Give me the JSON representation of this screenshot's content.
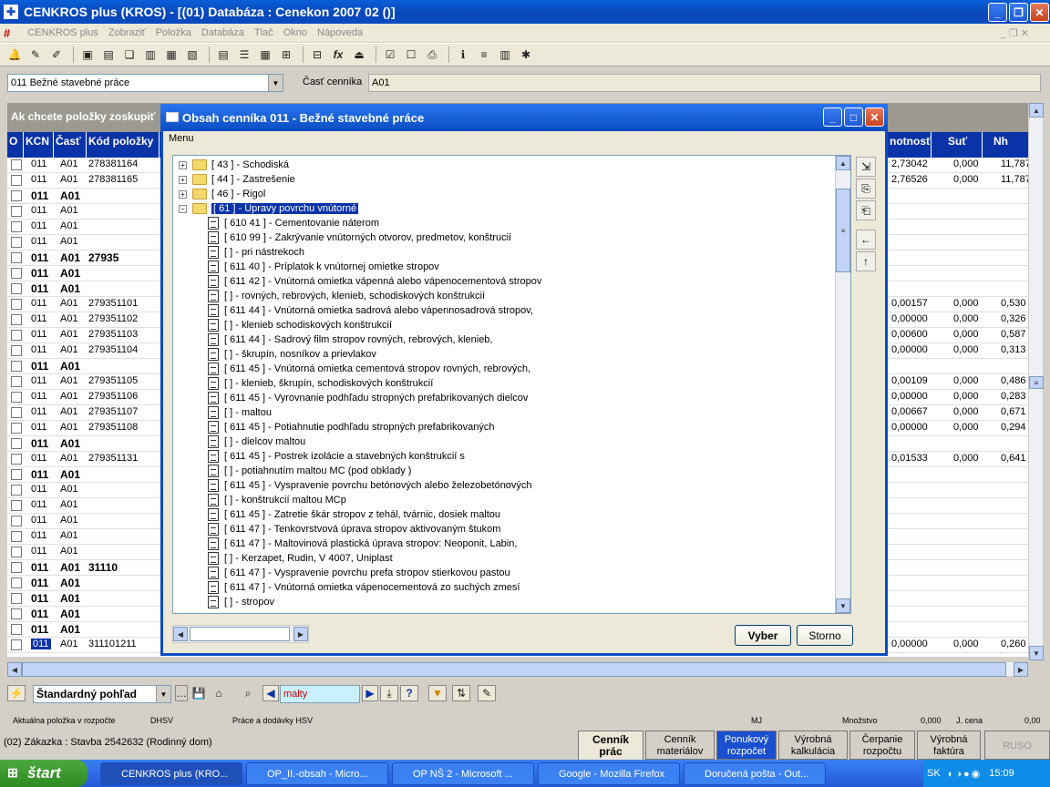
{
  "window": {
    "title": "CENKROS plus  (KROS) - [(01)  Databáza : Cenekon 2007 02 ()]"
  },
  "menu": {
    "items": [
      "CENKROS plus",
      "Zobraziť",
      "Položka",
      "Databáza",
      "Tlač",
      "Okno",
      "Nápoveda"
    ]
  },
  "selectors": {
    "category_value": "011  Bežné stavebné práce",
    "part_label": "Časť cenníka",
    "part_value": "A01"
  },
  "grid": {
    "group_hint": "Ak chcete položky zoskupiť",
    "columns": [
      "O",
      "KCN",
      "Časť",
      "Kód  položky",
      "notnosť",
      "Suť",
      "Nh"
    ],
    "rows": [
      {
        "kcn": "011",
        "cast": "A01",
        "kod": "278381164",
        "hm": "2,73042",
        "sut": "0,000",
        "nh": "11,787",
        "bold": false
      },
      {
        "kcn": "011",
        "cast": "A01",
        "kod": "278381165",
        "hm": "2,76526",
        "sut": "0,000",
        "nh": "11,787",
        "bold": false
      },
      {
        "kcn": "011",
        "cast": "A01",
        "kod": "",
        "hm": "",
        "sut": "",
        "nh": "",
        "bold": true
      },
      {
        "kcn": "011",
        "cast": "A01",
        "kod": "",
        "hm": "",
        "sut": "",
        "nh": "",
        "bold": false
      },
      {
        "kcn": "011",
        "cast": "A01",
        "kod": "",
        "hm": "",
        "sut": "",
        "nh": "",
        "bold": false
      },
      {
        "kcn": "011",
        "cast": "A01",
        "kod": "",
        "hm": "",
        "sut": "",
        "nh": "",
        "bold": false
      },
      {
        "kcn": "011",
        "cast": "A01",
        "kod": "27935",
        "hm": "",
        "sut": "",
        "nh": "",
        "bold": true
      },
      {
        "kcn": "011",
        "cast": "A01",
        "kod": "",
        "hm": "",
        "sut": "",
        "nh": "",
        "bold": true
      },
      {
        "kcn": "011",
        "cast": "A01",
        "kod": "",
        "hm": "",
        "sut": "",
        "nh": "",
        "bold": true
      },
      {
        "kcn": "011",
        "cast": "A01",
        "kod": "279351101",
        "hm": "0,00157",
        "sut": "0,000",
        "nh": "0,530",
        "bold": false
      },
      {
        "kcn": "011",
        "cast": "A01",
        "kod": "279351102",
        "hm": "0,00000",
        "sut": "0,000",
        "nh": "0,326",
        "bold": false
      },
      {
        "kcn": "011",
        "cast": "A01",
        "kod": "279351103",
        "hm": "0,00600",
        "sut": "0,000",
        "nh": "0,587",
        "bold": false
      },
      {
        "kcn": "011",
        "cast": "A01",
        "kod": "279351104",
        "hm": "0,00000",
        "sut": "0,000",
        "nh": "0,313",
        "bold": false
      },
      {
        "kcn": "011",
        "cast": "A01",
        "kod": "",
        "hm": "",
        "sut": "",
        "nh": "",
        "bold": true
      },
      {
        "kcn": "011",
        "cast": "A01",
        "kod": "279351105",
        "hm": "0,00109",
        "sut": "0,000",
        "nh": "0,486",
        "bold": false
      },
      {
        "kcn": "011",
        "cast": "A01",
        "kod": "279351106",
        "hm": "0,00000",
        "sut": "0,000",
        "nh": "0,283",
        "bold": false
      },
      {
        "kcn": "011",
        "cast": "A01",
        "kod": "279351107",
        "hm": "0,00667",
        "sut": "0,000",
        "nh": "0,671",
        "bold": false
      },
      {
        "kcn": "011",
        "cast": "A01",
        "kod": "279351108",
        "hm": "0,00000",
        "sut": "0,000",
        "nh": "0,294",
        "bold": false
      },
      {
        "kcn": "011",
        "cast": "A01",
        "kod": "",
        "hm": "",
        "sut": "",
        "nh": "",
        "bold": true
      },
      {
        "kcn": "011",
        "cast": "A01",
        "kod": "279351131",
        "hm": "0,01533",
        "sut": "0,000",
        "nh": "0,641",
        "bold": false
      },
      {
        "kcn": "011",
        "cast": "A01",
        "kod": "",
        "hm": "",
        "sut": "",
        "nh": "",
        "bold": true
      },
      {
        "kcn": "011",
        "cast": "A01",
        "kod": "",
        "hm": "",
        "sut": "",
        "nh": "",
        "bold": false
      },
      {
        "kcn": "011",
        "cast": "A01",
        "kod": "",
        "hm": "",
        "sut": "",
        "nh": "",
        "bold": false
      },
      {
        "kcn": "011",
        "cast": "A01",
        "kod": "",
        "hm": "",
        "sut": "",
        "nh": "",
        "bold": false
      },
      {
        "kcn": "011",
        "cast": "A01",
        "kod": "",
        "hm": "",
        "sut": "",
        "nh": "",
        "bold": false
      },
      {
        "kcn": "011",
        "cast": "A01",
        "kod": "",
        "hm": "",
        "sut": "",
        "nh": "",
        "bold": false
      },
      {
        "kcn": "011",
        "cast": "A01",
        "kod": "31110",
        "hm": "",
        "sut": "",
        "nh": "",
        "bold": true
      },
      {
        "kcn": "011",
        "cast": "A01",
        "kod": "",
        "hm": "",
        "sut": "",
        "nh": "",
        "bold": true
      },
      {
        "kcn": "011",
        "cast": "A01",
        "kod": "",
        "hm": "",
        "sut": "",
        "nh": "",
        "bold": true
      },
      {
        "kcn": "011",
        "cast": "A01",
        "kod": "",
        "hm": "",
        "sut": "",
        "nh": "",
        "bold": true
      },
      {
        "kcn": "011",
        "cast": "A01",
        "kod": "",
        "hm": "",
        "sut": "",
        "nh": "",
        "bold": true
      },
      {
        "kcn": "011",
        "cast": "A01",
        "kod": "311101211",
        "hm": "0,00000",
        "sut": "0,000",
        "nh": "0,260",
        "bold": false
      }
    ]
  },
  "dialog": {
    "title": "Obsah cenníka 011 - Bežné stavebné práce",
    "menu": "Menu",
    "tree": [
      {
        "text": "[ 43 ] - Schodiská",
        "type": "folder",
        "sel": false
      },
      {
        "text": "[ 44 ] - Zastrešenie",
        "type": "folder",
        "sel": false
      },
      {
        "text": "[ 46 ] - Rigol",
        "type": "folder",
        "sel": false
      },
      {
        "text": "[ 61 ] - Úpravy povrchu vnútorné",
        "type": "open",
        "sel": true
      },
      {
        "text": "[ 610 41 ] - Cementovanie náterom",
        "type": "doc",
        "sel": false
      },
      {
        "text": "[ 610 99 ] - Zakrývanie vnútorných otvorov, predmetov, konštrucií",
        "type": "doc",
        "sel": false
      },
      {
        "text": "[  ] - pri nástrekoch",
        "type": "doc",
        "sel": false
      },
      {
        "text": "[ 611 40 ] - Príplatok k vnútornej omietke stropov",
        "type": "doc",
        "sel": false
      },
      {
        "text": "[ 611 42 ] - Vnútorná omietka vápenná alebo vápenocementová stropov",
        "type": "doc",
        "sel": false
      },
      {
        "text": "[  ] - rovných, rebrových, klenieb, schodiskových konštrukcií",
        "type": "doc",
        "sel": false
      },
      {
        "text": "[ 611 44 ] - Vnútorná omietka sadrová alebo vápennosadrová stropov,",
        "type": "doc",
        "sel": false
      },
      {
        "text": "[  ] - klenieb schodiskových konštrukcií",
        "type": "doc",
        "sel": false
      },
      {
        "text": "[ 611 44 ] - Sadrový film stropov rovných, rebrových, klenieb,",
        "type": "doc",
        "sel": false
      },
      {
        "text": "[  ] - škrupín, nosníkov a prievlakov",
        "type": "doc",
        "sel": false
      },
      {
        "text": "[ 611 45 ] - Vnútorná omietka cementová stropov rovných, rebrových,",
        "type": "doc",
        "sel": false
      },
      {
        "text": "[  ] - klenieb, škrupín, schodiskových konštrukcií",
        "type": "doc",
        "sel": false
      },
      {
        "text": "[ 611 45 ] - Vyrovnanie podhľadu stropných prefabrikovaných dielcov",
        "type": "doc",
        "sel": false
      },
      {
        "text": "[  ] - maltou",
        "type": "doc",
        "sel": false
      },
      {
        "text": "[ 611 45 ] - Potiahnutie podhľadu stropných prefabrikovaných",
        "type": "doc",
        "sel": false
      },
      {
        "text": "[  ] - dielcov maltou",
        "type": "doc",
        "sel": false
      },
      {
        "text": "[ 611 45 ] - Postrek izolácie a stavebných konštrukcií s",
        "type": "doc",
        "sel": false
      },
      {
        "text": "[  ] - potiahnutím maltou MC (pod obklady )",
        "type": "doc",
        "sel": false
      },
      {
        "text": "[ 611 45 ] - Vyspravenie povrchu betónových alebo  železobetónových",
        "type": "doc",
        "sel": false
      },
      {
        "text": "[  ] - konštrukcií maltou MCp",
        "type": "doc",
        "sel": false
      },
      {
        "text": "[ 611 45 ] - Zatretie škár stropov z tehál, tvárnic, dosiek  maltou",
        "type": "doc",
        "sel": false
      },
      {
        "text": "[ 611 47 ] - Tenkovrstvová úprava stropov aktivovaným štukom",
        "type": "doc",
        "sel": false
      },
      {
        "text": "[ 611 47 ] - Maltovinová plastická úprava stropov: Neoponit, Labin,",
        "type": "doc",
        "sel": false
      },
      {
        "text": "[  ] - Kerzapet, Rudin, V 4007, Uniplast",
        "type": "doc",
        "sel": false
      },
      {
        "text": "[ 611 47 ] - Vyspravenie povrchu prefa stropov stierkovou pastou",
        "type": "doc",
        "sel": false
      },
      {
        "text": "[ 611 47 ] - Vnútorná omietka vápenocementová zo suchých zmesí",
        "type": "doc",
        "sel": false
      },
      {
        "text": "[  ] - stropov",
        "type": "doc",
        "sel": false
      }
    ],
    "select_button": "Vyber",
    "cancel_button": "Storno"
  },
  "bottom": {
    "view_value": "Štandardný pohľad",
    "search_value": "malty"
  },
  "status": {
    "current_label": "Aktuálna položka v rozpočte",
    "dhsv": "DHSV",
    "works": "Práce a dodávky HSV",
    "mj": "MJ",
    "qty_label": "Množstvo",
    "qty_value": "0,000",
    "price_label": "J. cena",
    "price_value": "0,00",
    "order": "(02)  Zákazka :  Stavba 2542632 (Rodinný dom)"
  },
  "tabs": [
    {
      "label": "Cenník\nprác",
      "active": true
    },
    {
      "label": "Cenník\nmateriálov",
      "active": false
    },
    {
      "label": "Ponukový\nrozpočet",
      "active": false,
      "highlight": true
    },
    {
      "label": "Výrobná\nkalkulácia",
      "active": false
    },
    {
      "label": "Čerpanie\nrozpočtu",
      "active": false
    },
    {
      "label": "Výrobná\nfaktúra",
      "active": false
    },
    {
      "label": "RUSO",
      "active": false
    }
  ],
  "taskbar": {
    "start": "štart",
    "tasks": [
      "CENKROS plus  (KRO...",
      "OP_II.-obsah - Micro...",
      "OP NŠ 2 - Microsoft ...",
      "Google - Mozilla Firefox",
      "Doručená pošta - Out..."
    ],
    "lang": "SK",
    "time": "15:09"
  }
}
